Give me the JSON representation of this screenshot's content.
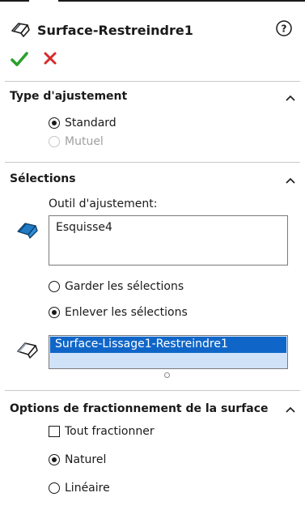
{
  "header": {
    "title": "Surface-Restreindre1",
    "icons": {
      "feature": "surface-trim-icon",
      "help": "help-icon",
      "ok": "checkmark-icon",
      "cancel": "close-icon"
    }
  },
  "type_ajustement": {
    "title": "Type d'ajustement",
    "options": [
      {
        "label": "Standard",
        "checked": true,
        "disabled": false
      },
      {
        "label": "Mutuel",
        "checked": false,
        "disabled": true
      }
    ]
  },
  "selections": {
    "title": "Sélections",
    "tool_label": "Outil d'ajustement:",
    "tool_items": [
      "Esquisse4"
    ],
    "keep_label": "Garder les sélections",
    "remove_label": "Enlever les sélections",
    "remove_checked": true,
    "selected_items": [
      "Surface-Lissage1-Restreindre1"
    ]
  },
  "options": {
    "title": "Options de fractionnement de la surface",
    "split_all_label": "Tout fractionner",
    "natural_label": "Naturel",
    "linear_label": "Linéaire",
    "natural_checked": true
  },
  "colors": {
    "accent_green": "#2aa12a",
    "cancel_red": "#d62b2b",
    "selection_blue": "#1066c8",
    "icon_blue": "#1f7bc4"
  }
}
